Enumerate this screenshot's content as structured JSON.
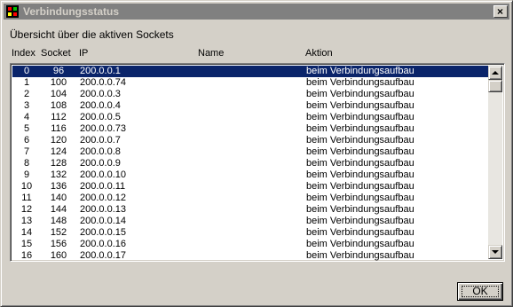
{
  "window": {
    "title": "Verbindungsstatus"
  },
  "description": "Übersicht über die aktiven Sockets",
  "columns": {
    "index": "Index",
    "socket": "Socket",
    "ip": "IP",
    "name": "Name",
    "aktion": "Aktion"
  },
  "rows": [
    {
      "index": "0",
      "socket": "96",
      "ip": "200.0.0.1",
      "name": "",
      "aktion": "beim Verbindungsaufbau",
      "selected": true
    },
    {
      "index": "1",
      "socket": "100",
      "ip": "200.0.0.74",
      "name": "",
      "aktion": "beim Verbindungsaufbau"
    },
    {
      "index": "2",
      "socket": "104",
      "ip": "200.0.0.3",
      "name": "",
      "aktion": "beim Verbindungsaufbau"
    },
    {
      "index": "3",
      "socket": "108",
      "ip": "200.0.0.4",
      "name": "",
      "aktion": "beim Verbindungsaufbau"
    },
    {
      "index": "4",
      "socket": "112",
      "ip": "200.0.0.5",
      "name": "",
      "aktion": "beim Verbindungsaufbau"
    },
    {
      "index": "5",
      "socket": "116",
      "ip": "200.0.0.73",
      "name": "",
      "aktion": "beim Verbindungsaufbau"
    },
    {
      "index": "6",
      "socket": "120",
      "ip": "200.0.0.7",
      "name": "",
      "aktion": "beim Verbindungsaufbau"
    },
    {
      "index": "7",
      "socket": "124",
      "ip": "200.0.0.8",
      "name": "",
      "aktion": "beim Verbindungsaufbau"
    },
    {
      "index": "8",
      "socket": "128",
      "ip": "200.0.0.9",
      "name": "",
      "aktion": "beim Verbindungsaufbau"
    },
    {
      "index": "9",
      "socket": "132",
      "ip": "200.0.0.10",
      "name": "",
      "aktion": "beim Verbindungsaufbau"
    },
    {
      "index": "10",
      "socket": "136",
      "ip": "200.0.0.11",
      "name": "",
      "aktion": "beim Verbindungsaufbau"
    },
    {
      "index": "11",
      "socket": "140",
      "ip": "200.0.0.12",
      "name": "",
      "aktion": "beim Verbindungsaufbau"
    },
    {
      "index": "12",
      "socket": "144",
      "ip": "200.0.0.13",
      "name": "",
      "aktion": "beim Verbindungsaufbau"
    },
    {
      "index": "13",
      "socket": "148",
      "ip": "200.0.0.14",
      "name": "",
      "aktion": "beim Verbindungsaufbau"
    },
    {
      "index": "14",
      "socket": "152",
      "ip": "200.0.0.15",
      "name": "",
      "aktion": "beim Verbindungsaufbau"
    },
    {
      "index": "15",
      "socket": "156",
      "ip": "200.0.0.16",
      "name": "",
      "aktion": "beim Verbindungsaufbau"
    },
    {
      "index": "16",
      "socket": "160",
      "ip": "200.0.0.17",
      "name": "",
      "aktion": "beim Verbindungsaufbau"
    }
  ],
  "buttons": {
    "ok": "OK"
  },
  "icons": {
    "app": "app-logo-icon",
    "close": "close-icon",
    "scroll_up": "arrow-up-icon",
    "scroll_down": "arrow-down-icon"
  },
  "colors": {
    "selection": "#0a246a",
    "titlebar_inactive": "#808080",
    "face": "#d4d0c8"
  }
}
